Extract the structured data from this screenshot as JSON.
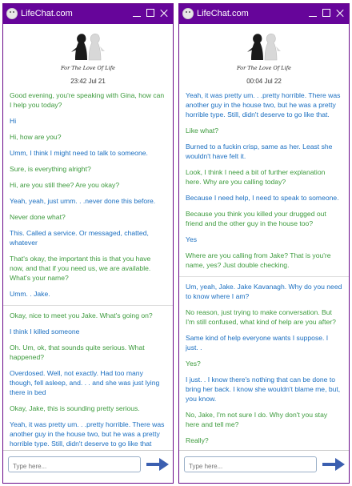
{
  "app": {
    "title": "LifeChat.com",
    "tagline": "For The Love Of Life",
    "input_placeholder": "Type here...",
    "icons": {
      "app": "chat-face-icon",
      "minimize": "minimize-icon",
      "maximize": "maximize-icon",
      "close": "close-icon",
      "send": "send-arrow-icon",
      "logo": "two-figures-logo"
    },
    "colors": {
      "titlebar": "#66059a",
      "gina_text": "#3c9a3c",
      "user_text": "#1a6ec0",
      "send_arrow": "#3b5fb0"
    }
  },
  "windows": [
    {
      "timestamp": "23:42 Jul 21",
      "messages": [
        {
          "from": "gina",
          "text": "Good evening, you're speaking with Gina, how can I help you today?"
        },
        {
          "from": "user",
          "text": "Hi"
        },
        {
          "from": "gina",
          "text": "Hi, how are you?"
        },
        {
          "from": "user",
          "text": "Umm, I think I might need to talk to someone."
        },
        {
          "from": "gina",
          "text": "Sure, is everything alright?"
        },
        {
          "from": "gina",
          "text": "Hi, are you still thee? Are you okay?"
        },
        {
          "from": "user",
          "text": "Yeah, yeah, just umm. . .never done this before."
        },
        {
          "from": "gina",
          "text": "Never done what?"
        },
        {
          "from": "user",
          "text": "This. Called a service. Or messaged, chatted, whatever"
        },
        {
          "from": "gina",
          "text": "That's okay, the important this is that you have now, and that if you need us, we are available. What's your name?"
        },
        {
          "from": "user",
          "text": "Umm. . Jake.",
          "divider": true
        },
        {
          "from": "gina",
          "text": "Okay, nice to meet you Jake. What's going on?"
        },
        {
          "from": "user",
          "text": "I think I killed someone"
        },
        {
          "from": "gina",
          "text": "Oh. Um, ok, that sounds quite serious. What happened?"
        },
        {
          "from": "user",
          "text": "Overdosed. Well, not exactly. Had too many though, fell asleep, and. . . and she was just lying there in bed"
        },
        {
          "from": "gina",
          "text": "Okay, Jake, this is sounding pretty serious."
        },
        {
          "from": "user",
          "text": "Yeah, it was pretty um. . .pretty horrible. There was another guy in the house two, but he was a pretty horrible type. Still, didn't deserve to go like that"
        }
      ]
    },
    {
      "timestamp": "00:04 Jul 22",
      "messages": [
        {
          "from": "user",
          "text": "Yeah, it was pretty um. . .pretty horrible. There was another guy in the house two, but he was a pretty horrible type. Still, didn't deserve to go like that."
        },
        {
          "from": "gina",
          "text": "Like what?"
        },
        {
          "from": "user",
          "text": "Burned to a fuckin crisp, same as her. Least she wouldn't have felt it."
        },
        {
          "from": "gina",
          "text": "Look, I think I need a bit of further explanation here. Why are you calling today?"
        },
        {
          "from": "user",
          "text": "Because I need help, I need to speak to someone."
        },
        {
          "from": "gina",
          "text": "Because you think you killed your drugged out friend and the other guy in the house too?"
        },
        {
          "from": "user",
          "text": "Yes"
        },
        {
          "from": "gina",
          "text": "Where are you calling from Jake? That is you're name, yes? Just double checking.",
          "divider": true
        },
        {
          "from": "user",
          "text": "Um, yeah, Jake. Jake Kavanagh. Why do you need to know where I am?"
        },
        {
          "from": "gina",
          "text": "No reason, just trying to make conversation. But I'm still confused, what kind of help are you after?"
        },
        {
          "from": "user",
          "text": "Same kind of help everyone wants I suppose. I just. ."
        },
        {
          "from": "gina",
          "text": "Yes?"
        },
        {
          "from": "user",
          "text": "I just. . I know there's nothing that can be done to bring her back. I know she wouldn't blame me, but, you know."
        },
        {
          "from": "gina",
          "text": "No, Jake, I'm not sure I do. Why don't you stay here and tell me?"
        },
        {
          "from": "gina",
          "text": "Really?"
        }
      ]
    }
  ]
}
